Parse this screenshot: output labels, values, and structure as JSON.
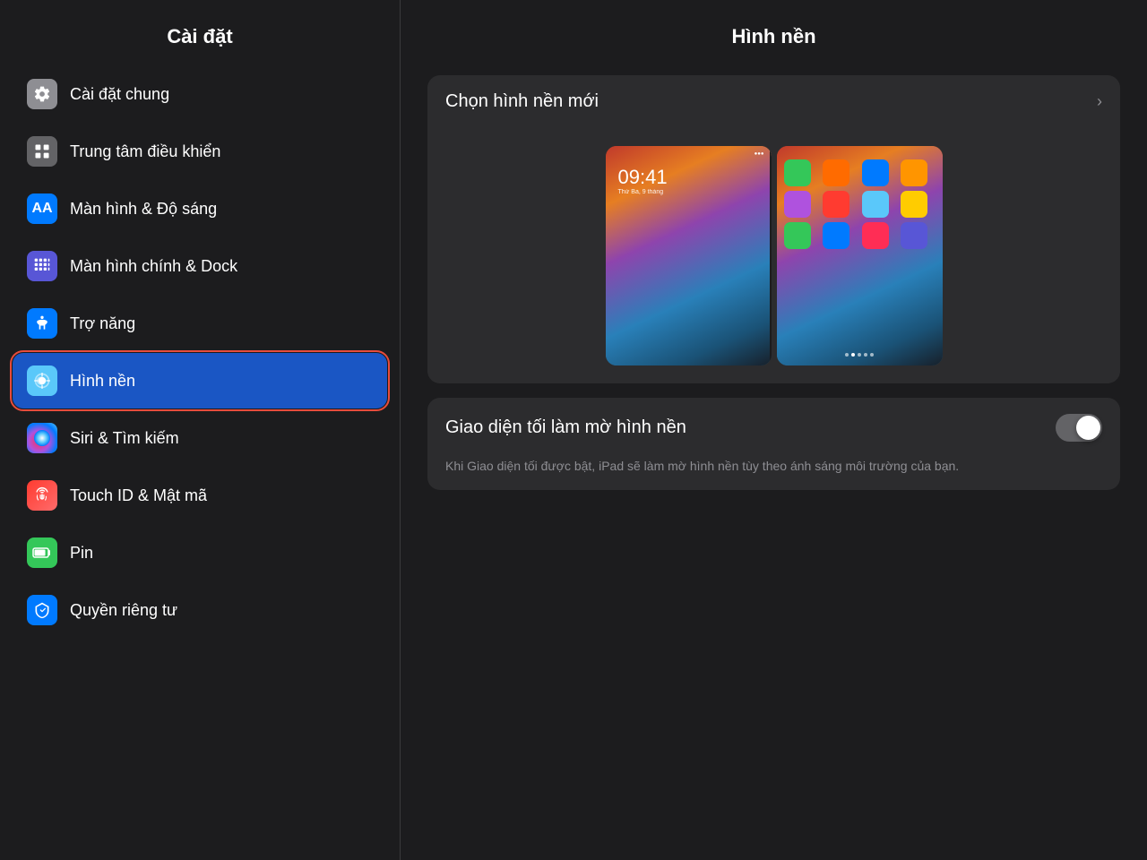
{
  "sidebar": {
    "title": "Cài đặt",
    "items": [
      {
        "id": "general",
        "label": "Cài đặt chung",
        "icon": "gear",
        "iconClass": "icon-gear",
        "active": false
      },
      {
        "id": "control-center",
        "label": "Trung tâm điều khiển",
        "icon": "control-center",
        "iconClass": "icon-control",
        "active": false
      },
      {
        "id": "display",
        "label": "Màn hình & Độ sáng",
        "icon": "display",
        "iconClass": "icon-display",
        "active": false
      },
      {
        "id": "homescreen",
        "label": "Màn hình chính & Dock",
        "icon": "homescreen",
        "iconClass": "icon-homescreen",
        "active": false
      },
      {
        "id": "accessibility",
        "label": "Trợ năng",
        "icon": "accessibility",
        "iconClass": "icon-accessibility",
        "active": false
      },
      {
        "id": "wallpaper",
        "label": "Hình nền",
        "icon": "wallpaper",
        "iconClass": "icon-wallpaper",
        "active": true
      },
      {
        "id": "siri",
        "label": "Siri & Tìm kiếm",
        "icon": "siri",
        "iconClass": "icon-siri",
        "active": false
      },
      {
        "id": "touchid",
        "label": "Touch ID & Mật mã",
        "icon": "touchid",
        "iconClass": "icon-touchid",
        "active": false
      },
      {
        "id": "battery",
        "label": "Pin",
        "icon": "battery",
        "iconClass": "icon-battery",
        "active": false
      },
      {
        "id": "privacy",
        "label": "Quyền riêng tư",
        "icon": "privacy",
        "iconClass": "icon-privacy",
        "active": false
      }
    ]
  },
  "main": {
    "title": "Hình nền",
    "choose_wallpaper_label": "Chọn hình nền mới",
    "dark_mode_label": "Giao diện tối làm mờ hình nền",
    "dark_mode_description": "Khi Giao diện tối được bật, iPad sẽ làm mờ hình nền tùy theo ánh sáng môi trường của bạn.",
    "lock_time": "09:41",
    "lock_date": "Thứ Ba, 9 tháng",
    "toggle_on": false
  },
  "icons": {
    "gear": "⚙",
    "chevron_right": "›",
    "fingerprint": "✦",
    "siri_emoji": "🎤"
  }
}
